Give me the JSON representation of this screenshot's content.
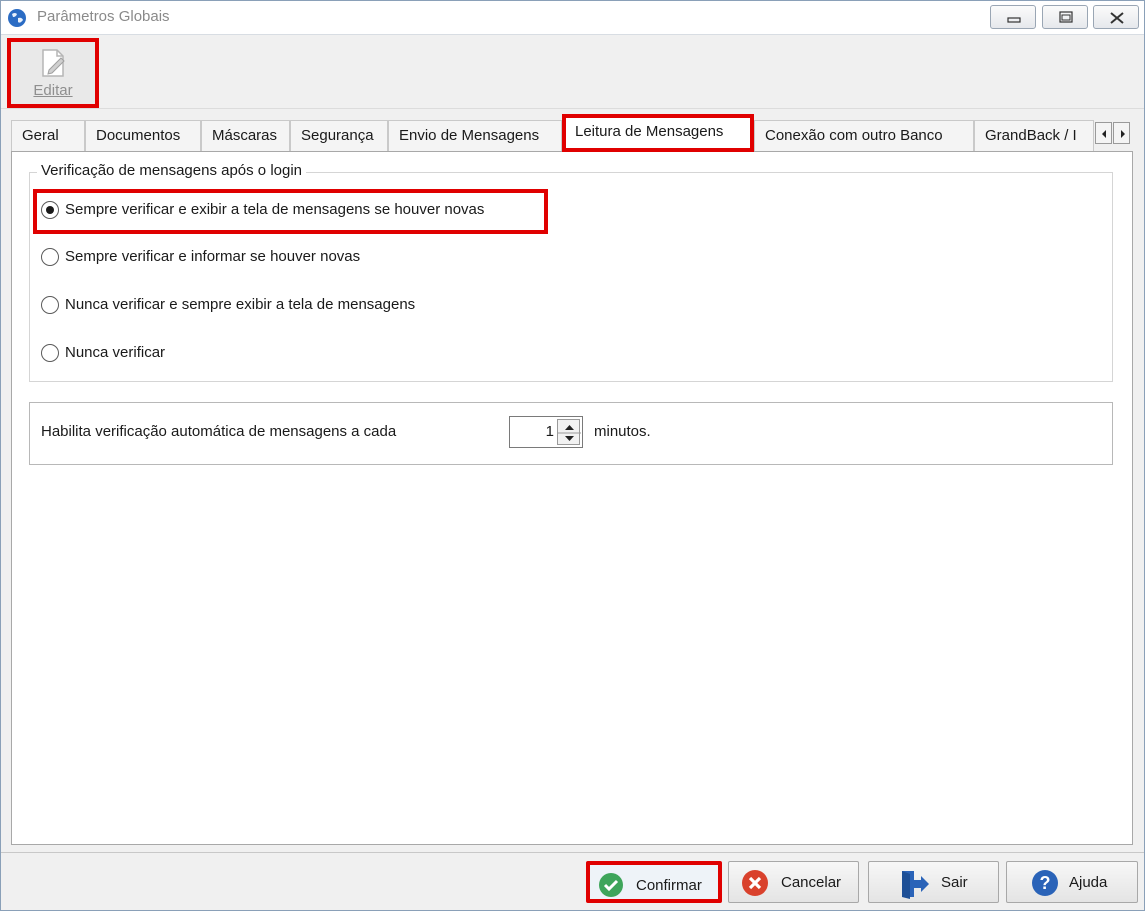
{
  "window": {
    "title": "Parâmetros Globais",
    "controls": {
      "minimize_icon": "minimize-icon",
      "restore_icon": "restore-icon",
      "close_icon": "close-icon"
    }
  },
  "toolbar": {
    "edit_label": "Editar",
    "edit_icon": "edit-document-icon"
  },
  "tabs": [
    {
      "label": "Geral",
      "active": false
    },
    {
      "label": "Documentos",
      "active": false
    },
    {
      "label": "Máscaras",
      "active": false
    },
    {
      "label": "Segurança",
      "active": false
    },
    {
      "label": "Envio de Mensagens",
      "active": false
    },
    {
      "label": "Leitura de Mensagens",
      "active": true
    },
    {
      "label": "Conexão com outro Banco",
      "active": false
    },
    {
      "label": "GrandBack / I",
      "active": false
    }
  ],
  "message_check": {
    "legend": "Verificação de mensagens após o login",
    "options": [
      {
        "label": "Sempre verificar e exibir a tela de mensagens se houver novas",
        "selected": true
      },
      {
        "label": "Sempre verificar e informar se houver novas",
        "selected": false
      },
      {
        "label": "Nunca verificar e sempre exibir a tela de mensagens",
        "selected": false
      },
      {
        "label": "Nunca verificar",
        "selected": false
      }
    ]
  },
  "auto_check": {
    "label": "Habilita verificação automática de mensagens a cada",
    "value": "1",
    "unit": "minutos."
  },
  "footer": {
    "confirm_label": "Confirmar",
    "cancel_label": "Cancelar",
    "exit_label": "Sair",
    "help_label": "Ajuda"
  },
  "colors": {
    "highlight": "#e00000",
    "confirm_green": "#3ea55a",
    "cancel_red": "#d9412c",
    "help_blue": "#2a63b8"
  }
}
